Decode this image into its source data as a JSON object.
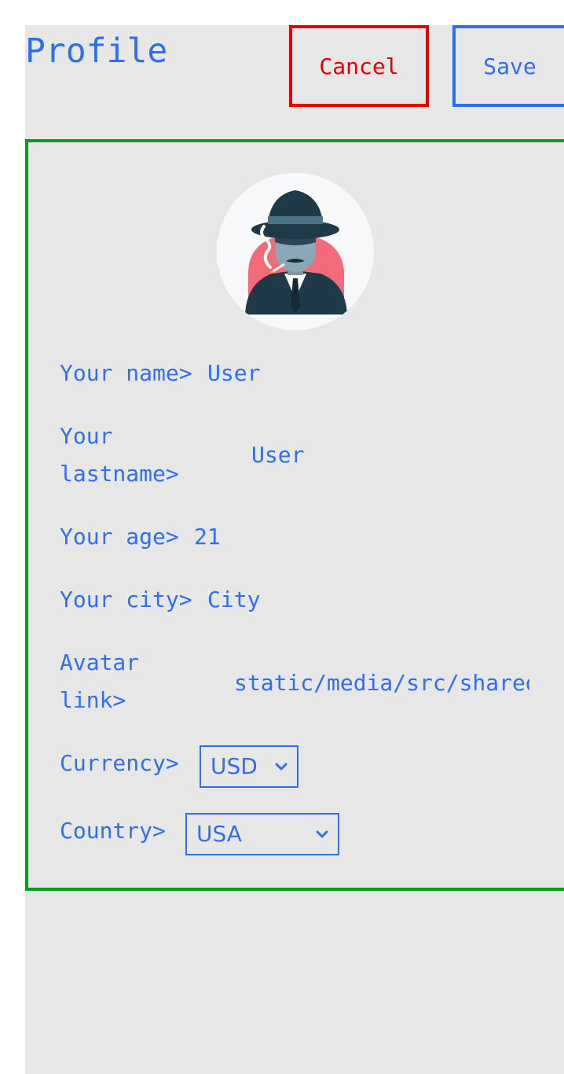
{
  "header": {
    "title": "Profile",
    "cancel_label": "Cancel",
    "save_label": "Save"
  },
  "profile": {
    "avatar_icon": "detective-avatar-icon",
    "fields": {
      "name_label": "Your name>",
      "name_value": "User",
      "lastname_label": "Your lastname>",
      "lastname_value": "User",
      "age_label": "Your age>",
      "age_value": "21",
      "city_label": "Your city>",
      "city_value": "City",
      "avatar_label": "Avatar link>",
      "avatar_value": "static/media/src/shared",
      "currency_label": "Currency>",
      "currency_value": "USD",
      "country_label": "Country>",
      "country_value": "USA"
    }
  },
  "colors": {
    "accent": "#2f6fec",
    "cancel": "#e60000",
    "card_border": "#0a9b1a",
    "panel_bg": "#e7e7e7"
  }
}
